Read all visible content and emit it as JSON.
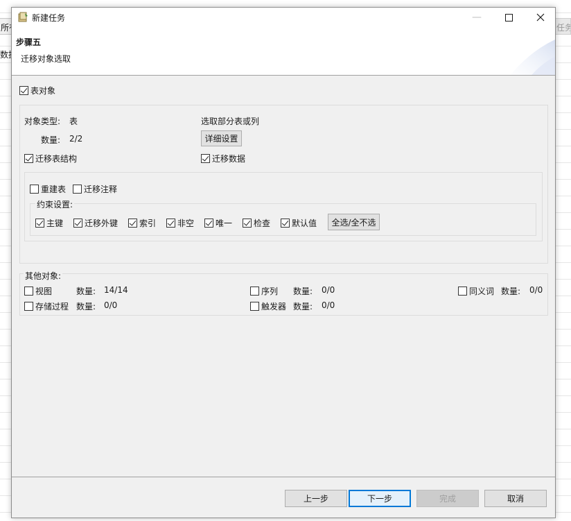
{
  "background": {
    "left_tab": "所有",
    "left_label": "数据",
    "right_tab": "任务"
  },
  "window": {
    "title": "新建任务",
    "minimize_glyph": "—",
    "maximize_glyph": "☐",
    "close_glyph": "✕"
  },
  "header": {
    "step": "步骤五",
    "subtitle": "迁移对象选取"
  },
  "table_objects": {
    "label": "表对象",
    "checked": true,
    "type_label": "对象类型:",
    "type_value": "表",
    "count_label": "数量:",
    "count_value": "2/2",
    "select_label": "选取部分表或列",
    "detail_button": "详细设置",
    "migrate_structure": "迁移表结构",
    "migrate_data": "迁移数据",
    "rebuild_table": "重建表",
    "migrate_comments": "迁移注释",
    "constraints_label": "约束设置:",
    "constraints": [
      {
        "label": "主键",
        "checked": true
      },
      {
        "label": "迁移外键",
        "checked": true
      },
      {
        "label": "索引",
        "checked": true
      },
      {
        "label": "非空",
        "checked": true
      },
      {
        "label": "唯一",
        "checked": true
      },
      {
        "label": "检查",
        "checked": true
      },
      {
        "label": "默认值",
        "checked": true
      }
    ],
    "select_all_button": "全选/全不选"
  },
  "other_objects": {
    "label": "其他对象:",
    "count_label": "数量:",
    "items": [
      {
        "label": "视图",
        "count": "14/14",
        "checked": false
      },
      {
        "label": "序列",
        "count": "0/0",
        "checked": false
      },
      {
        "label": "同义词",
        "count": "0/0",
        "checked": false
      },
      {
        "label": "存储过程",
        "count": "0/0",
        "checked": false
      },
      {
        "label": "触发器",
        "count": "0/0",
        "checked": false
      }
    ]
  },
  "footer": {
    "prev": "上一步",
    "next": "下一步",
    "finish": "完成",
    "cancel": "取消"
  }
}
